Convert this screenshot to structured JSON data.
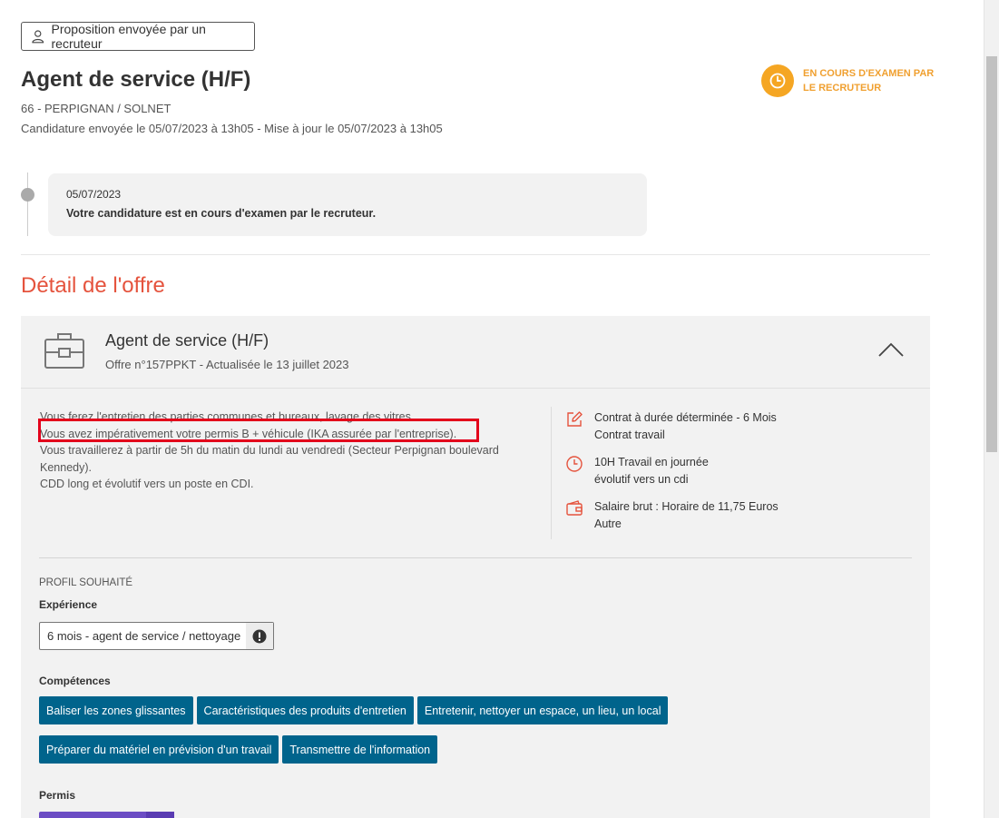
{
  "header": {
    "recruiter_button": "Proposition envoyée par un recruteur",
    "title": "Agent de service (H/F)",
    "location": "66 - PERPIGNAN / SOLNET",
    "sent_info": "Candidature envoyée le 05/07/2023 à 13h05 - Mise à jour le 05/07/2023 à 13h05",
    "status_text": "EN COURS D'EXAMEN PAR LE RECRUTEUR",
    "status_color": "#f5a623"
  },
  "timeline": {
    "date": "05/07/2023",
    "message": "Votre candidature est en cours d'examen par le recruteur."
  },
  "section_title": "Détail de l'offre",
  "offer": {
    "title": "Agent de service (H/F)",
    "subtitle": "Offre n°157PPKT - Actualisée le 13 juillet 2023",
    "description": [
      "Vous ferez l'entretien des parties communes et bureaux, lavage des vitres.",
      "Vous avez impérativement votre permis B + véhicule (IKA assurée par l'entreprise).",
      "Vous travaillerez à partir de 5h du matin du lundi au vendredi (Secteur Perpignan boulevard Kennedy).",
      "CDD long et évolutif vers un poste en CDI."
    ],
    "contract": [
      "Contrat à durée déterminée - 6 Mois",
      "Contrat travail"
    ],
    "schedule": [
      "10H Travail en journée",
      "évolutif vers un cdi"
    ],
    "salary": [
      "Salaire brut : Horaire de 11,75 Euros",
      "Autre"
    ],
    "profile_label": "PROFIL SOUHAITÉ",
    "experience_label": "Expérience",
    "experience_value": "6 mois - agent de service / nettoyage",
    "skills_label": "Compétences",
    "skills": [
      "Baliser les zones glissantes",
      "Caractéristiques des produits d'entretien",
      "Entretenir, nettoyer un espace, un lieu, un local",
      "Préparer du matériel en prévision d'un travail",
      "Transmettre de l'information"
    ],
    "permis_label": "Permis"
  },
  "colors": {
    "accent_red": "#e5533d",
    "chip_blue": "#00648c",
    "highlight_red": "#e3001b",
    "permis_purple": "#6c4dc4"
  }
}
